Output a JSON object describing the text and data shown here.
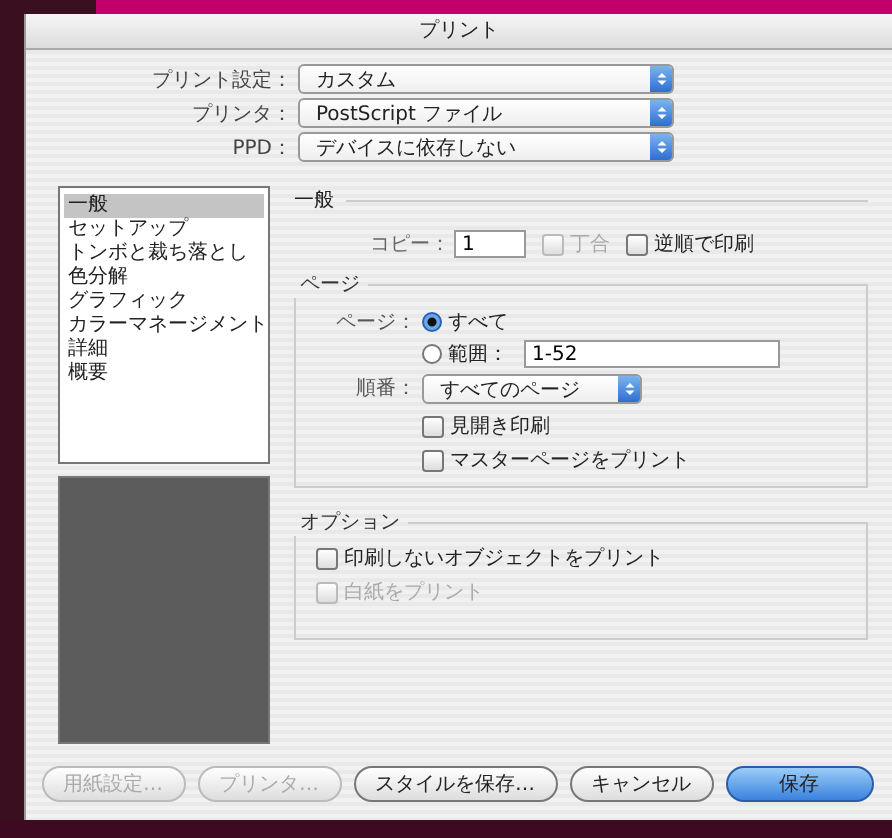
{
  "dialog": {
    "title": "プリント"
  },
  "settings": [
    {
      "label": "プリント設定：",
      "value": "カスタム"
    },
    {
      "label": "プリンタ：",
      "value": "PostScript ファイル"
    },
    {
      "label": "PPD：",
      "value": "デバイスに依存しない"
    }
  ],
  "sections": [
    {
      "label": "一般",
      "selected": true
    },
    {
      "label": "セットアップ",
      "selected": false
    },
    {
      "label": "トンボと裁ち落とし",
      "selected": false
    },
    {
      "label": "色分解",
      "selected": false
    },
    {
      "label": "グラフィック",
      "selected": false
    },
    {
      "label": "カラーマネージメント",
      "selected": false
    },
    {
      "label": "詳細",
      "selected": false
    },
    {
      "label": "概要",
      "selected": false
    }
  ],
  "general": {
    "heading": "一般",
    "copies_label": "コピー：",
    "copies": "1",
    "checkboxes": [
      {
        "label": "丁合",
        "checked": false,
        "disabled": true
      },
      {
        "label": "逆順で印刷",
        "checked": false,
        "disabled": false
      }
    ]
  },
  "pages": {
    "legend": "ページ",
    "label": "ページ：",
    "radios": [
      {
        "label": "すべて",
        "selected": true
      },
      {
        "label": "範囲：",
        "selected": false
      }
    ],
    "range": "1-52",
    "order_label": "順番：",
    "order": "すべてのページ",
    "checkboxes": [
      {
        "label": "見開き印刷",
        "checked": false,
        "disabled": false
      },
      {
        "label": "マスターページをプリント",
        "checked": false,
        "disabled": false
      }
    ]
  },
  "options": {
    "legend": "オプション",
    "checkboxes": [
      {
        "label": "印刷しないオブジェクトをプリント",
        "checked": false,
        "disabled": false
      },
      {
        "label": "白紙をプリント",
        "checked": false,
        "disabled": true
      }
    ]
  },
  "buttons": [
    {
      "label": "用紙設定…",
      "disabled": true,
      "default": false
    },
    {
      "label": "プリンタ…",
      "disabled": true,
      "default": false
    },
    {
      "label": "スタイルを保存…",
      "disabled": false,
      "default": false
    },
    {
      "label": "キャンセル",
      "disabled": false,
      "default": false
    },
    {
      "label": "保存",
      "disabled": false,
      "default": true
    }
  ]
}
